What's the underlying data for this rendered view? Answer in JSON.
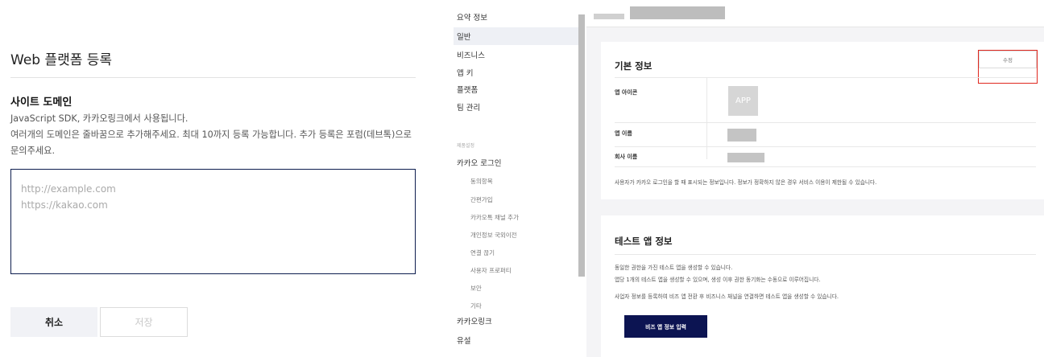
{
  "dialog": {
    "title": "Web 플랫폼 등록",
    "section_title": "사이트 도메인",
    "description_1": "JavaScript SDK, 카카오링크에서 사용됩니다.",
    "description_2": "여러개의 도메인은 줄바꿈으로 추가해주세요. 최대 10까지 등록 가능합니다. 추가 등록은 포럼(데브톡)으로 문의주세요.",
    "placeholder_line_1": "http://example.com",
    "placeholder_line_2": "https://kakao.com",
    "cancel_label": "취소",
    "save_label": "저장"
  },
  "sidebar": {
    "items": [
      {
        "label": "요약 정보"
      },
      {
        "label": "일반"
      },
      {
        "label": "비즈니스"
      },
      {
        "label": "앱 키"
      },
      {
        "label": "플랫폼"
      },
      {
        "label": "팀 관리"
      }
    ],
    "section_label": "제품설정",
    "kakao_login": "카카오 로그인",
    "sub_items": [
      {
        "label": "동의항목"
      },
      {
        "label": "간편가입"
      },
      {
        "label": "카카오톡 채널 추가"
      },
      {
        "label": "개인정보 국외이전"
      },
      {
        "label": "연결 끊기"
      },
      {
        "label": "사용자 프로퍼티"
      },
      {
        "label": "보안"
      },
      {
        "label": "기타"
      }
    ],
    "kakao_link": "카카오링크",
    "cut_off_item": "유설"
  },
  "main": {
    "basic_info": {
      "title": "기본 정보",
      "edit_label": "수정",
      "app_icon_label": "앱 아이콘",
      "app_icon_text": "APP",
      "app_name_label": "앱 이름",
      "company_name_label": "회사 이름",
      "note": "사용자가 카카오 로그인을 할 때 표시되는 정보입니다. 정보가 정확하지 않은 경우 서비스 이용이 제한될 수 있습니다."
    },
    "test_app": {
      "title": "테스트 앱 정보",
      "note_1": "동일한 권한을 가진 테스트 앱을 생성할 수 있습니다.",
      "note_2": "앱당 1개의 테스트 앱을 생성할 수 있으며, 생성 이후 권한 동기화는 수동으로 이루어집니다.",
      "note_3": "사업자 정보를 등록하여 비즈 앱 전환 후 비즈니스 채널을 연결하면 테스트 앱을 생성할 수 있습니다.",
      "button_label": "비즈 앱 정보 입력"
    }
  },
  "colors": {
    "navy_button": "#0c1452",
    "textarea_border": "#0d1d4e",
    "highlight": "#e0271e",
    "sidebar_active": "#eef0f5"
  }
}
